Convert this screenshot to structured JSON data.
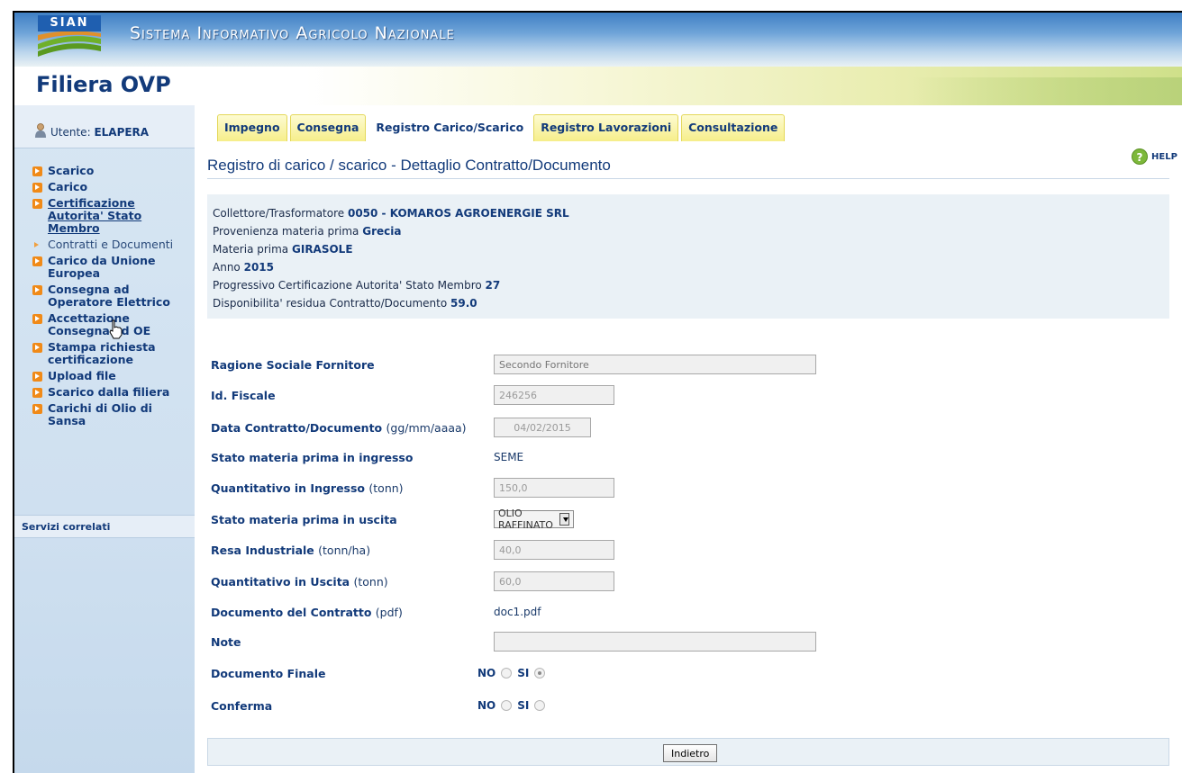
{
  "header": {
    "logo_text": "SIAN",
    "site_title": "Sistema Informativo Agricolo Nazionale",
    "app_title": "Filiera OVP"
  },
  "user": {
    "label": "Utente:",
    "name": "ELAPERA"
  },
  "sidebar": {
    "items": [
      {
        "label": "Scarico"
      },
      {
        "label": "Carico"
      },
      {
        "label": "Certificazione Autorita' Stato Membro"
      },
      {
        "label": "Contratti e Documenti"
      },
      {
        "label": "Carico da Unione Europea"
      },
      {
        "label": "Consegna ad Operatore Elettrico"
      },
      {
        "label": "Accettazione Consegna ad OE"
      },
      {
        "label": "Stampa richiesta certificazione"
      },
      {
        "label": "Upload file"
      },
      {
        "label": "Scarico dalla filiera"
      },
      {
        "label": "Carichi di Olio di Sansa"
      }
    ],
    "related_title": "Servizi correlati"
  },
  "tabs": [
    {
      "label": "Impegno"
    },
    {
      "label": "Consegna"
    },
    {
      "label": "Registro Carico/Scarico"
    },
    {
      "label": "Registro Lavorazioni"
    },
    {
      "label": "Consultazione"
    }
  ],
  "help_label": "HELP",
  "page_title": "Registro di carico / scarico - Dettaglio Contratto/Documento",
  "info": {
    "collettore_label": "Collettore/Trasformatore",
    "collettore_value": "0050 - KOMAROS AGROENERGIE SRL",
    "provenienza_label": "Provenienza materia prima",
    "provenienza_value": "Grecia",
    "materia_label": "Materia prima",
    "materia_value": "GIRASOLE",
    "anno_label": "Anno",
    "anno_value": "2015",
    "progressivo_label": "Progressivo Certificazione Autorita' Stato Membro",
    "progressivo_value": "27",
    "disponibilita_label": "Disponibilita' residua Contratto/Documento",
    "disponibilita_value": "59.0"
  },
  "form": {
    "ragione_label": "Ragione Sociale Fornitore",
    "ragione_placeholder": "Secondo Fornitore",
    "idfiscale_label": "Id. Fiscale",
    "idfiscale_value": "246256",
    "data_label": "Data Contratto/Documento",
    "data_unit": "(gg/mm/aaaa)",
    "data_value": "04/02/2015",
    "stato_in_label": "Stato materia prima in ingresso",
    "stato_in_value": "SEME",
    "qty_in_label": "Quantitativo in Ingresso",
    "qty_in_unit": "(tonn)",
    "qty_in_value": "150,0",
    "stato_out_label": "Stato materia prima in uscita",
    "stato_out_value": "OLIO RAFFINATO",
    "resa_label": "Resa Industriale",
    "resa_unit": "(tonn/ha)",
    "resa_value": "40,0",
    "qty_out_label": "Quantitativo in Uscita",
    "qty_out_unit": "(tonn)",
    "qty_out_value": "60,0",
    "doc_label": "Documento del Contratto",
    "doc_unit": "(pdf)",
    "doc_value": "doc1.pdf",
    "note_label": "Note",
    "note_value": "",
    "finale_label": "Documento Finale",
    "finale_selected": "SI",
    "conferma_label": "Conferma",
    "conferma_selected": "",
    "no_label": "NO",
    "si_label": "SI"
  },
  "back_button": "Indietro"
}
